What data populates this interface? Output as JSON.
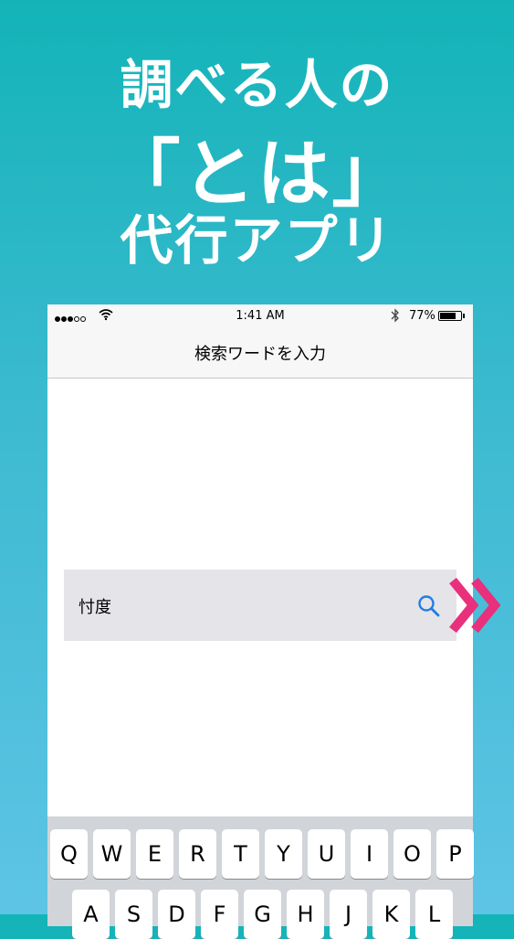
{
  "promo": {
    "line1": "調べる人の",
    "line2": "「とは」",
    "line3": "代行アプリ"
  },
  "status_bar": {
    "time": "1:41 AM",
    "battery": "77%",
    "battery_level": 0.77,
    "signal_bars": 3,
    "signal_total": 5
  },
  "nav": {
    "title": "検索ワードを入力"
  },
  "search": {
    "query": "忖度",
    "button_icon": "search-icon"
  },
  "keyboard": {
    "row1": [
      "Q",
      "W",
      "E",
      "R",
      "T",
      "Y",
      "U",
      "I",
      "O",
      "P"
    ],
    "row2": [
      "A",
      "S",
      "D",
      "F",
      "G",
      "H",
      "J",
      "K",
      "L"
    ]
  },
  "colors": {
    "accent_pink": "#e8307c",
    "search_blue": "#1f7fe0"
  }
}
